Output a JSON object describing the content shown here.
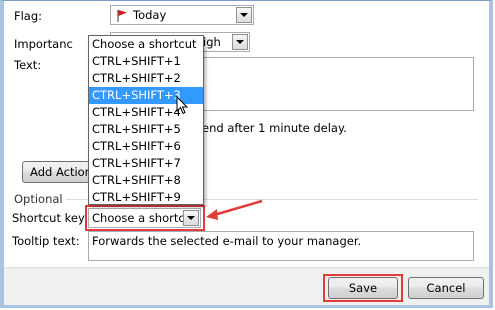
{
  "form": {
    "flag_label": "Flag:",
    "flag_value": "Today",
    "importance_label": "Importanc",
    "importance_value": "igh",
    "text_label": "Text:",
    "send_delay_text": "end after 1 minute delay.",
    "add_action_label": "Add Action",
    "optional_label": "Optional",
    "shortcut_label": "Shortcut key:",
    "shortcut_value": "Choose a shortcut",
    "tooltip_label": "Tooltip text:",
    "tooltip_value": "Forwards the selected e-mail to your manager."
  },
  "shortcut_list": {
    "items": [
      "Choose a shortcut",
      "CTRL+SHIFT+1",
      "CTRL+SHIFT+2",
      "CTRL+SHIFT+3",
      "CTRL+SHIFT+4",
      "CTRL+SHIFT+5",
      "CTRL+SHIFT+6",
      "CTRL+SHIFT+7",
      "CTRL+SHIFT+8",
      "CTRL+SHIFT+9"
    ],
    "selected_index": 3
  },
  "footer": {
    "save_label": "Save",
    "cancel_label": "Cancel"
  },
  "colors": {
    "highlight": "#3399ff",
    "annotation_red": "#e03c3c",
    "flag_red": "#d42020"
  }
}
